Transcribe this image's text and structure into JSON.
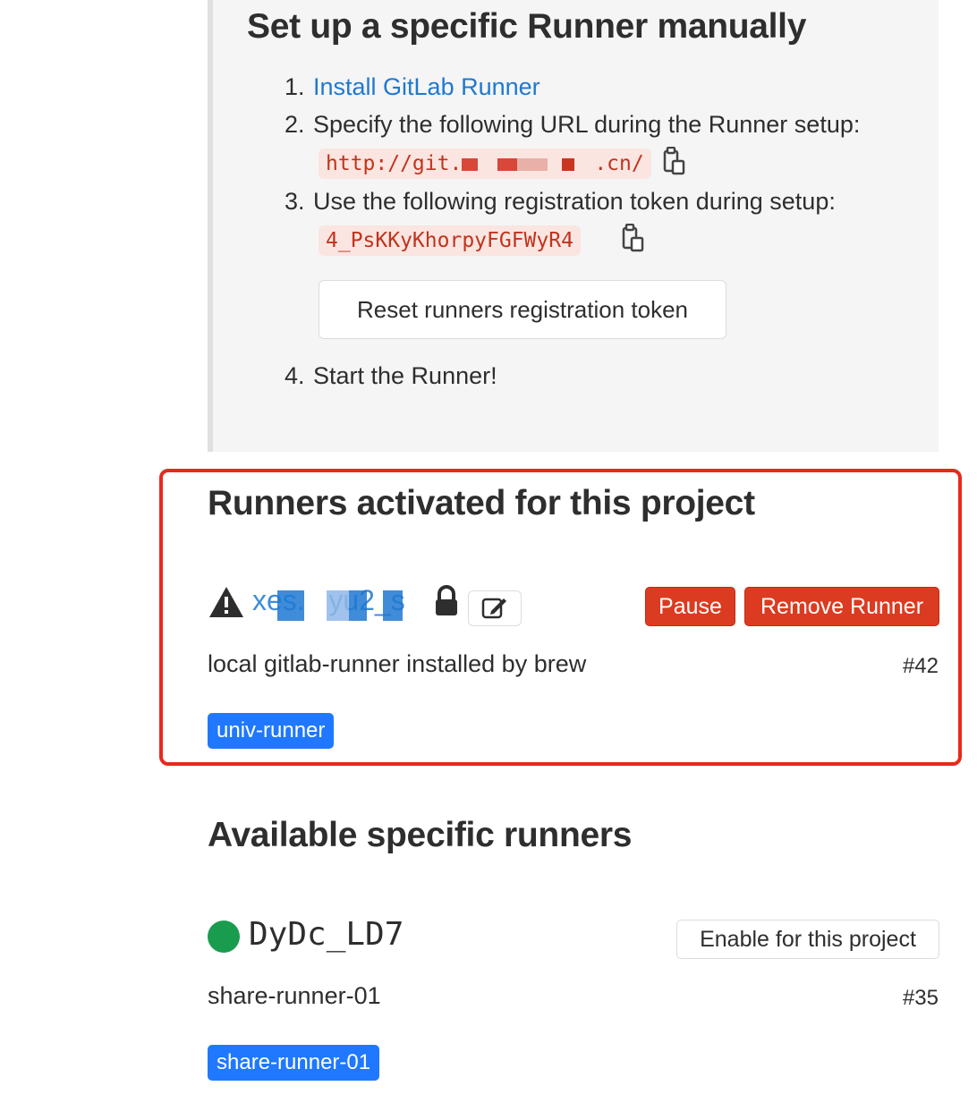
{
  "setup": {
    "title": "Set up a specific Runner manually",
    "step1_num": "1.",
    "step1_link": "Install GitLab Runner",
    "step2_num": "2.",
    "step2_text": "Specify the following URL during the Runner setup:",
    "url_prefix": "http://git.",
    "url_suffix": ".cn/",
    "step3_num": "3.",
    "step3_text": "Use the following registration token during setup:",
    "token": "4_PsKKyKhorpyFGFWyR4",
    "reset_button": "Reset runners registration token",
    "step4_num": "4.",
    "step4_text": "Start the Runner!"
  },
  "activated": {
    "title": "Runners activated for this project",
    "runner": {
      "name": "xes.   yu2_s",
      "description": "local gitlab-runner installed by brew",
      "id": "#42",
      "tag": "univ-runner",
      "pause_button": "Pause",
      "remove_button": "Remove Runner"
    }
  },
  "available": {
    "title": "Available specific runners",
    "runner": {
      "name": "DyDc_LD7",
      "description": "share-runner-01",
      "id": "#35",
      "tag": "share-runner-01",
      "enable_button": "Enable for this project",
      "status_color": "#1a9c4f"
    }
  },
  "colors": {
    "link": "#1f78d1",
    "danger": "#db3b21",
    "highlight_border": "#e8291c",
    "tag": "#1f78ff",
    "code_text": "#c0341d",
    "code_bg": "#fbe5e1"
  },
  "icons": [
    "clipboard-icon",
    "warning-icon",
    "lock-icon",
    "edit-icon",
    "status-online-icon"
  ]
}
